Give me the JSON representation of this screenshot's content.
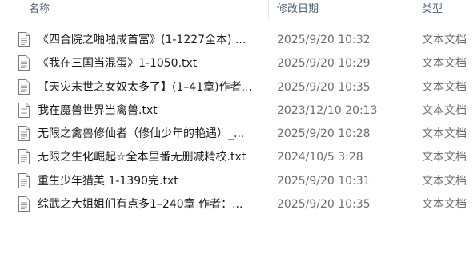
{
  "header": {
    "name_label": "名称",
    "date_label": "修改日期",
    "type_label": "类型"
  },
  "file_icon": "text-document-icon",
  "files": [
    {
      "name": "《四合院之啪啪成首富》(1-1227全本) ...",
      "date": "2025/9/20 10:32",
      "type": "文本文档"
    },
    {
      "name": "《我在三国当混蛋》1-1050.txt",
      "date": "2025/9/20 10:29",
      "type": "文本文档"
    },
    {
      "name": "【天灾末世之女奴太多了】(1–41章)作者...",
      "date": "2025/9/20 10:35",
      "type": "文本文档"
    },
    {
      "name": "我在魔兽世界当禽兽.txt",
      "date": "2023/12/10 20:13",
      "type": "文本文档"
    },
    {
      "name": "无限之禽兽修仙者（修仙少年的艳遇）_...",
      "date": "2025/9/20 10:28",
      "type": "文本文档"
    },
    {
      "name": "无限之生化崛起☆全本里番无删减精校.txt",
      "date": "2024/10/5 3:28",
      "type": "文本文档"
    },
    {
      "name": "重生少年猎美 1-1390完.txt",
      "date": "2025/9/20 10:31",
      "type": "文本文档"
    },
    {
      "name": "综武之大姐姐们有点多1–240章 作者：...",
      "date": "2025/9/20 10:35",
      "type": "文本文档"
    }
  ]
}
